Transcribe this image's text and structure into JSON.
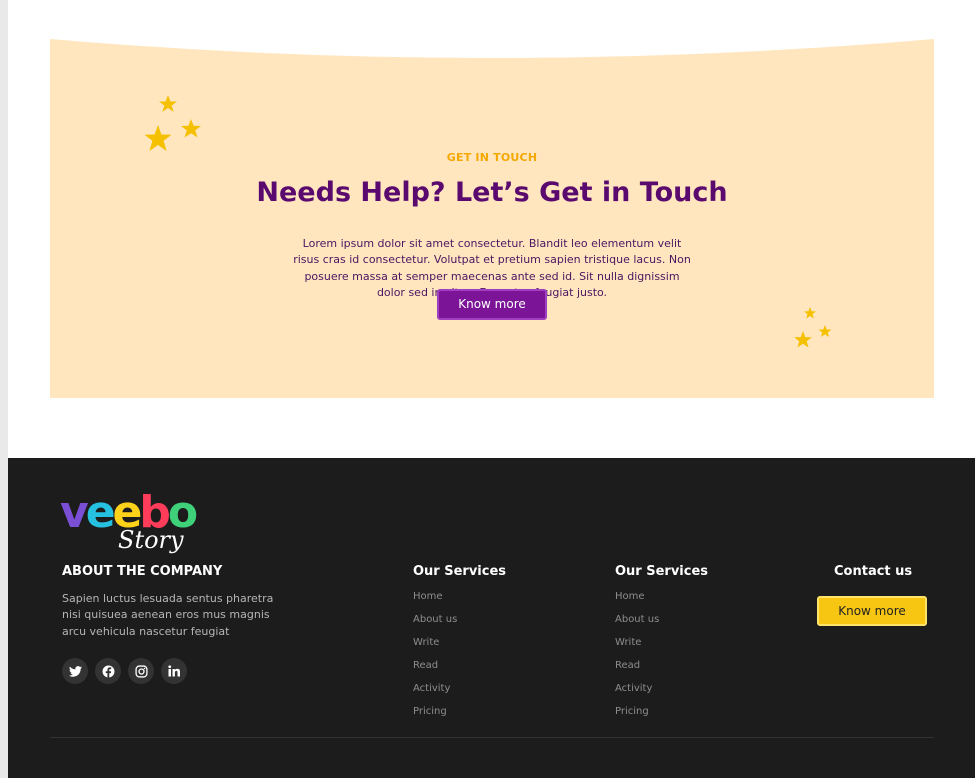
{
  "cta": {
    "eyebrow": "GET IN TOUCH",
    "title": "Needs Help? Let’s Get in Touch",
    "body": "Lorem ipsum dolor sit amet consectetur. Blandit leo elementum velit risus cras id consectetur. Volutpat et pretium sapien tristique lacus. Non posuere massa at semper maecenas ante sed id. Sit nulla dignissim dolor sed in vitae. Eu metus feugiat justo.",
    "button_label": "Know more",
    "background_color": "#ffe6bf",
    "accent_color": "#5a0a6e",
    "star_color": "#f5c000"
  },
  "footer": {
    "logo": {
      "word": "veebo",
      "tagline": "Story",
      "letter_colors": [
        "#7a4fd6",
        "#26c0e0",
        "#ffd21a",
        "#ff3d5a",
        "#3fd07a"
      ]
    },
    "about": {
      "title": "ABOUT THE COMPANY",
      "text": "Sapien luctus lesuada sentus pharetra nisi quisuea aenean eros mus magnis arcu vehicula nascetur feugiat"
    },
    "socials": [
      "twitter-icon",
      "facebook-icon",
      "instagram-icon",
      "linkedin-icon"
    ],
    "columns": [
      {
        "title": "Our Services",
        "links": [
          "Home",
          "About us",
          "Write",
          "Read",
          "Activity",
          "Pricing"
        ]
      },
      {
        "title": "Our Services",
        "links": [
          "Home",
          "About us",
          "Write",
          "Read",
          "Activity",
          "Pricing"
        ]
      }
    ],
    "contact": {
      "title": "Contact us",
      "button_label": "Know more"
    },
    "background_color": "#1c1c1c",
    "button_color": "#f7c613"
  }
}
